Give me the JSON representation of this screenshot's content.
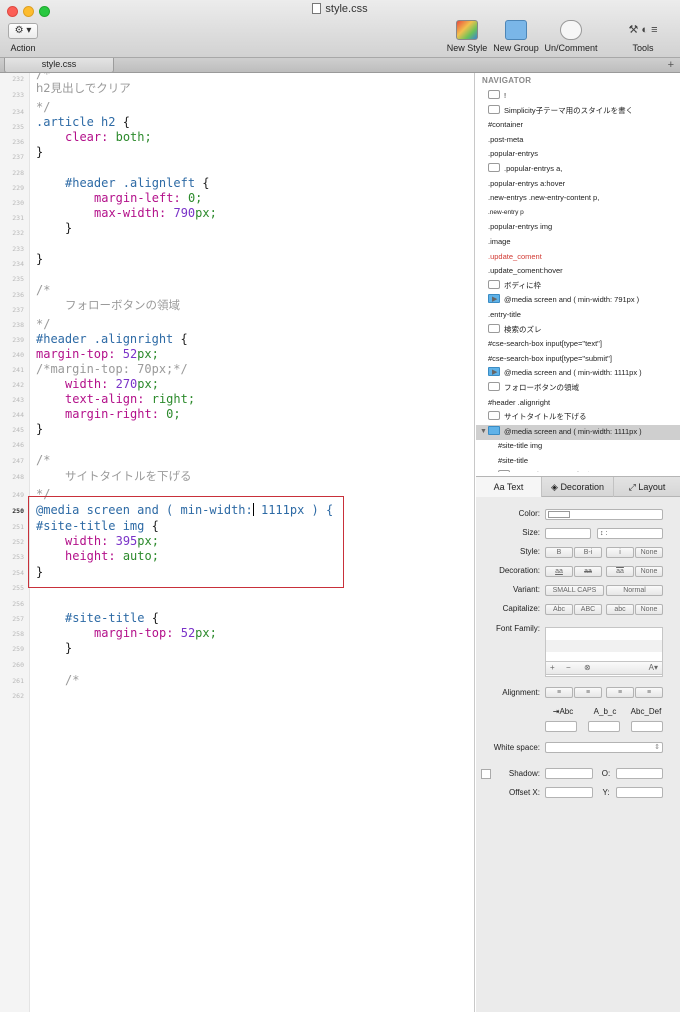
{
  "window": {
    "title": "style.css"
  },
  "toolbar": {
    "action_label": "Action",
    "action_icon": "gear-icon",
    "new_style": "New Style",
    "new_group": "New Group",
    "uncomment": "Un/Comment",
    "tools": "Tools"
  },
  "tabs": {
    "active": "style.css",
    "add": "+"
  },
  "editor": {
    "current_line": "250",
    "line_numbers": [
      "232",
      "233",
      "234",
      "235",
      "236",
      "237",
      "228",
      "229",
      "230",
      "231",
      "232",
      "233",
      "234",
      "235",
      "236",
      "237",
      "238",
      "239",
      "240",
      "241",
      "242",
      "243",
      "244",
      "245",
      "246",
      "247",
      "248",
      "249",
      "250",
      "251",
      "252",
      "253",
      "254",
      "255",
      "256",
      "257",
      "258",
      "259",
      "260",
      "261",
      "262"
    ],
    "code": {
      "l1": "h2見出しでクリア",
      "l2": "*/",
      "l3_sel": ".article h2",
      "brace_open": "{",
      "brace_close": "}",
      "clear_prop": "clear:",
      "clear_val": "both;",
      "header_left_sel": "#header .alignleft",
      "ml_prop": "margin-left:",
      "ml_val": "0;",
      "mw_prop": "max-width:",
      "mw_num": "790",
      "mw_unit": "px;",
      "cmt_open": "/*",
      "cmt_follow": "フォローボタンの領域",
      "cmt_close": "*/",
      "header_right_sel": "#header .alignright",
      "mt_prop": "margin-top:",
      "mt_num": "52",
      "mt_unit": "px;",
      "mt_cmt": "/*margin-top: 70px;*/",
      "w_prop": "width:",
      "w_num": "270",
      "w_unit": "px;",
      "ta_prop": "text-align:",
      "ta_val": "right;",
      "mr_prop": "margin-right:",
      "mr_val": "0;",
      "cmt_site": "サイトタイトルを下げる",
      "media_kw": "@media",
      "media_rest": " screen and ( min-width:",
      "media_num": " 1111px ) {",
      "site_img_sel": "#site-title img",
      "w2_num": "395",
      "h_prop": "height:",
      "h_val": "auto;",
      "site_sel": "#site-title",
      "mt2_num": "52"
    }
  },
  "navigator": {
    "header": "NAVIGATOR",
    "items": [
      {
        "label": "!",
        "kind": "comment"
      },
      {
        "label": "Simplicity子テーマ用のスタイルを書く",
        "kind": "comment"
      },
      {
        "label": "#container",
        "kind": "rule"
      },
      {
        "label": ".post-meta",
        "kind": "rule"
      },
      {
        "label": ".popular-entrys",
        "kind": "rule"
      },
      {
        "label": ".popular-entrys a,",
        "kind": "comment"
      },
      {
        "label": ".popular-entrys a:hover",
        "kind": "rule"
      },
      {
        "label": ".new-entrys .new-entry-content p,",
        "kind": "rule"
      },
      {
        "label": ".new-entry p",
        "kind": "rule"
      },
      {
        "label": ".popular-entrys img",
        "kind": "rule"
      },
      {
        "label": ".image",
        "kind": "rule"
      },
      {
        "label": ".update_coment",
        "kind": "rule"
      },
      {
        "label": ".update_coment:hover",
        "kind": "rule"
      },
      {
        "label": "ボディに枠",
        "kind": "comment"
      },
      {
        "label": "@media screen and ( min-width: 791px )",
        "kind": "group"
      },
      {
        "label": ".entry-title",
        "kind": "rule"
      },
      {
        "label": "検索のズレ",
        "kind": "comment"
      },
      {
        "label": "#cse-search-box input[type=\"text\"]",
        "kind": "rule"
      },
      {
        "label": "#cse-search-box input[type=\"submit\"]",
        "kind": "rule"
      },
      {
        "label": "@media screen and ( min-width: 1111px )",
        "kind": "group"
      },
      {
        "label": "フォローボタンの領域",
        "kind": "comment"
      },
      {
        "label": "#header .alignright",
        "kind": "rule"
      },
      {
        "label": "サイトタイトルを下げる",
        "kind": "comment"
      },
      {
        "label": "@media screen and ( min-width: 1111px )",
        "kind": "group"
      },
      {
        "label": "#site-title img",
        "kind": "rule"
      },
      {
        "label": "#site-title",
        "kind": "rule"
      },
      {
        "label": "サイト概要の下を広げる",
        "kind": "comment"
      }
    ]
  },
  "inspector": {
    "tabs": [
      "Text",
      "Decoration",
      "Layout"
    ],
    "color_label": "Color:",
    "size_label": "Size:",
    "style_label": "Style:",
    "style_opts": [
      "B",
      "B-i",
      "i",
      "None"
    ],
    "decoration_label": "Decoration:",
    "deco_opts": [
      "aa",
      "aa",
      "aa",
      "None"
    ],
    "variant_label": "Variant:",
    "variant_opts": [
      "SMALL CAPS",
      "Normal"
    ],
    "capitalize_label": "Capitalize:",
    "cap_opts": [
      "Abc",
      "ABC",
      "abc",
      "None"
    ],
    "font_family_label": "Font Family:",
    "alignment_label": "Alignment:",
    "indent_labels": [
      "Abc",
      "A_b_c",
      "Abc_Def"
    ],
    "white_space_label": "White space:",
    "shadow_label": "Shadow:",
    "shadow_o_label": "O:",
    "offset_x_label": "Offset X:",
    "offset_y_label": "Y:"
  },
  "colors": {
    "highlight_box": "#c8303a",
    "selector": "#2d6aa5",
    "property": "#b3108a",
    "value": "#2c8a2c",
    "number": "#7a33c8",
    "comment": "#9a9a9a"
  }
}
